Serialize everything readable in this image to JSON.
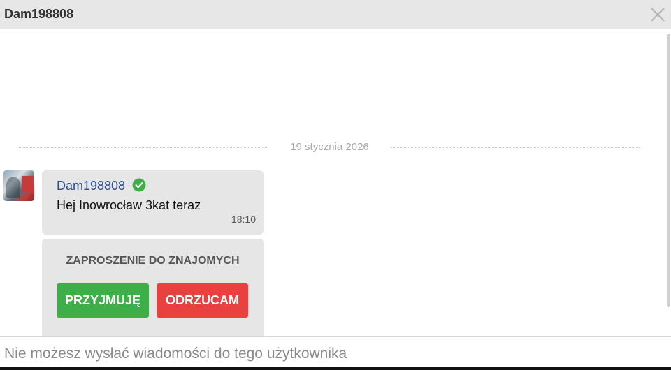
{
  "header": {
    "title": "Dam198808",
    "close_icon": "close-icon"
  },
  "conversation": {
    "date_separator": "19 stycznia 2026",
    "message": {
      "author": "Dam198808",
      "verified_icon": "check-circle-icon",
      "text": "Hej Inowrocław 3kat teraz",
      "time": "18:10"
    },
    "friend_request": {
      "title": "ZAPROSZENIE DO ZNAJOMYCH",
      "accept_label": "PRZYJMUJĘ",
      "reject_label": "ODRZUCAM"
    }
  },
  "footer": {
    "notice": "Nie możesz wysłać wiadomości do tego użytkownika"
  },
  "colors": {
    "header_bg": "#e7e7e7",
    "bubble_bg": "#e6e6e6",
    "author": "#2c4f8f",
    "verified": "#3eae48",
    "accept": "#3eae48",
    "reject": "#e94040"
  }
}
